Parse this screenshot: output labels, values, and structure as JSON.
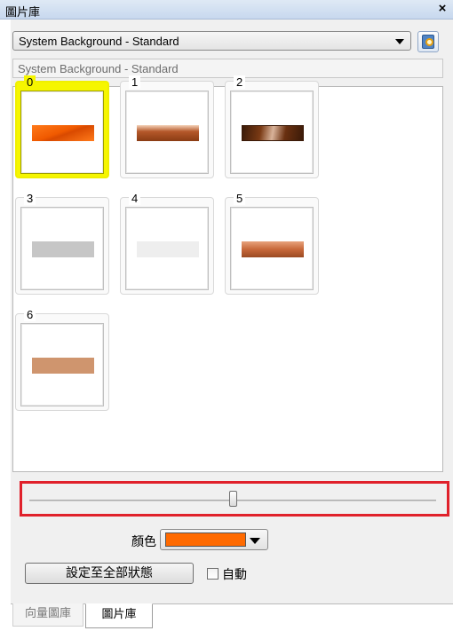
{
  "window": {
    "title": "圖片庫",
    "close_glyph": "×"
  },
  "library_dropdown": {
    "selected": "System Background - Standard"
  },
  "name_field": {
    "value": "System Background - Standard"
  },
  "gallery": {
    "items": [
      {
        "label": "0",
        "selected": true,
        "fill": "#f05a00",
        "style": "diagonal-orange"
      },
      {
        "label": "1",
        "selected": false,
        "fill": "#b5582a",
        "style": "copper-gloss"
      },
      {
        "label": "2",
        "selected": false,
        "fill": "#7a3a14",
        "style": "dark-copper-gloss"
      },
      {
        "label": "3",
        "selected": false,
        "fill": "#c6c6c6",
        "style": "flat"
      },
      {
        "label": "4",
        "selected": false,
        "fill": "#eeeeee",
        "style": "flat"
      },
      {
        "label": "5",
        "selected": false,
        "fill": "#c8683a",
        "style": "copper-soft"
      },
      {
        "label": "6",
        "selected": false,
        "fill": "#cf956e",
        "style": "flat"
      }
    ]
  },
  "slider": {
    "value_fraction": 0.5
  },
  "color": {
    "label": "顏色",
    "value": "#ff6a00"
  },
  "apply_button": {
    "label": "設定至全部狀態"
  },
  "auto_checkbox": {
    "label": "自動",
    "checked": false
  },
  "tabs": [
    {
      "label": "向量圖庫",
      "active": false
    },
    {
      "label": "圖片庫",
      "active": true
    }
  ],
  "colors": {
    "accent_highlight": "#f6f600",
    "slider_highlight_border": "#e0212b"
  }
}
